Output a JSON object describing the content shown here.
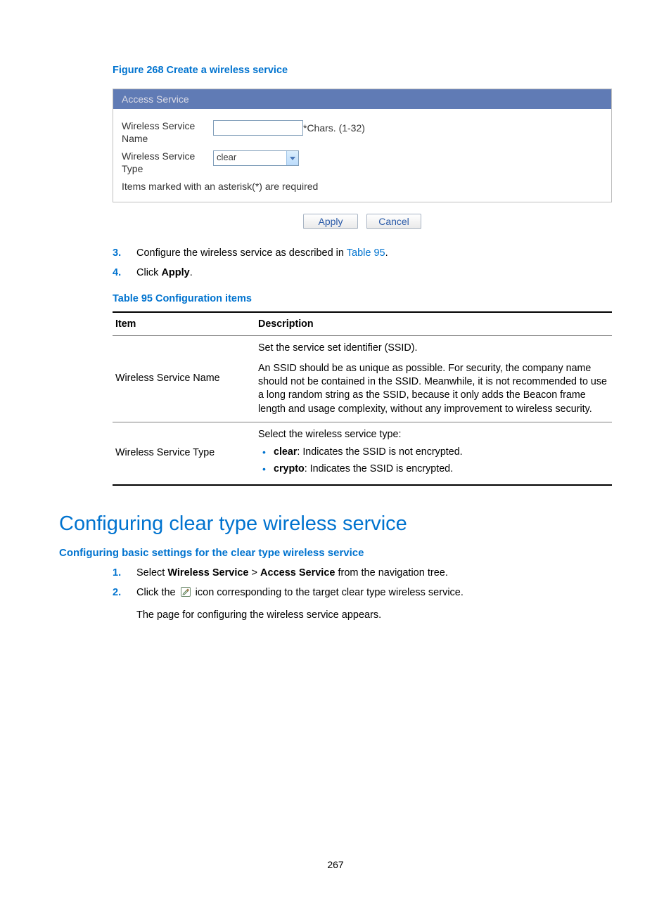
{
  "figure_caption": "Figure 268 Create a wireless service",
  "figure": {
    "tab_label": "Access Service",
    "rows": {
      "name_label": "Wireless Service Name",
      "name_hint": "*Chars. (1-32)",
      "type_label": "Wireless Service Type",
      "type_value": "clear"
    },
    "required_note": "Items marked with an asterisk(*) are required",
    "apply": "Apply",
    "cancel": "Cancel"
  },
  "steps_a": {
    "s3_num": "3.",
    "s3_a": "Configure the wireless service as described in ",
    "s3_link": "Table 95",
    "s3_b": ".",
    "s4_num": "4.",
    "s4_a": "Click ",
    "s4_bold": "Apply",
    "s4_b": "."
  },
  "table_caption": "Table 95 Configuration items",
  "table": {
    "head_item": "Item",
    "head_desc": "Description",
    "r1_item": "Wireless Service Name",
    "r1_p1": "Set the service set identifier (SSID).",
    "r1_p2": "An SSID should be as unique as possible. For security, the company name should not be contained in the SSID. Meanwhile, it is not recommended to use a long random string as the SSID, because it only adds the Beacon frame length and usage complexity, without any improvement to wireless security.",
    "r2_item": "Wireless Service Type",
    "r2_p1": "Select the wireless service type:",
    "r2_b1_bold": "clear",
    "r2_b1_rest": ": Indicates the SSID is not encrypted.",
    "r2_b2_bold": "crypto",
    "r2_b2_rest": ": Indicates the SSID is encrypted."
  },
  "section_h2": "Configuring clear type wireless service",
  "section_h3": "Configuring basic settings for the clear type wireless service",
  "steps_b": {
    "s1_num": "1.",
    "s1_a": "Select ",
    "s1_bold1": "Wireless Service",
    "s1_mid": " > ",
    "s1_bold2": "Access Service",
    "s1_b": " from the navigation tree.",
    "s2_num": "2.",
    "s2_a": "Click the ",
    "s2_b": " icon corresponding to the target clear type wireless service.",
    "s2_after": "The page for configuring the wireless service appears."
  },
  "page_number": "267"
}
